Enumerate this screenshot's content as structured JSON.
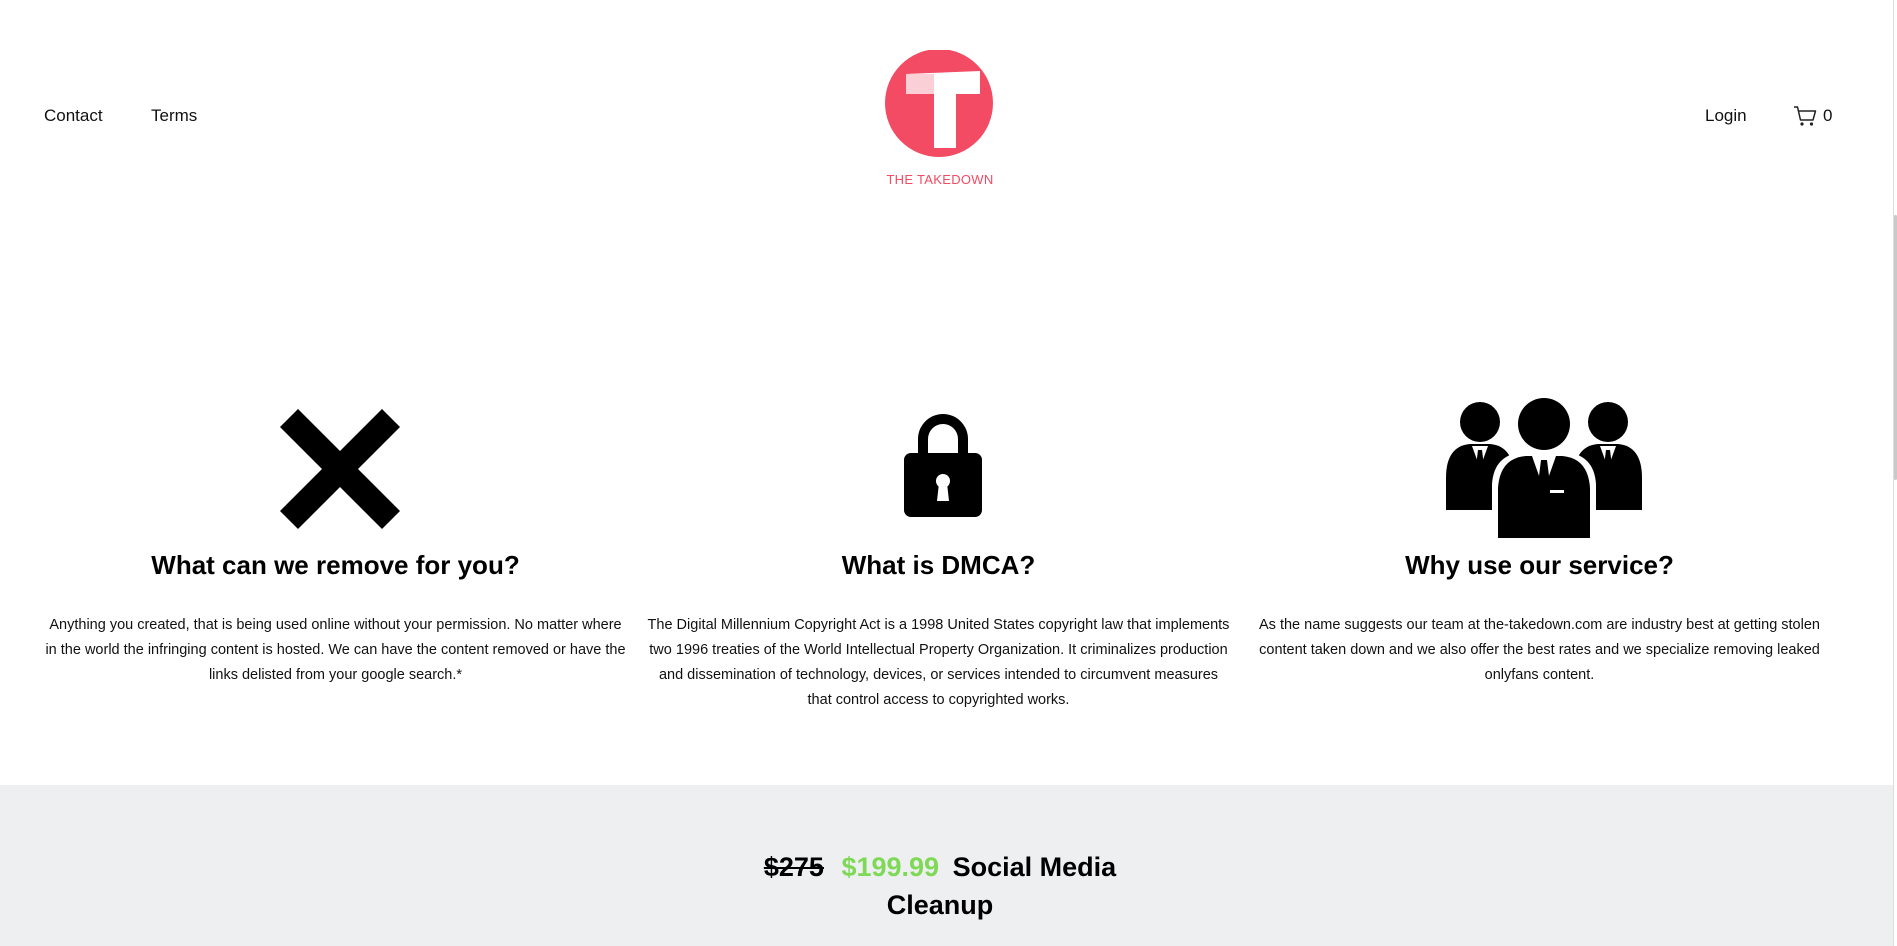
{
  "header": {
    "nav": [
      "Contact",
      "Terms"
    ],
    "logo_text": "THE TAKEDOWN",
    "login_label": "Login",
    "cart_count": "0"
  },
  "features": [
    {
      "icon": "x-icon",
      "title": "What can we remove for you?",
      "body": "Anything you created, that is being used online without your permission. No matter where in the world the infringing content is hosted. We can have the content removed or have the links delisted from your google search.*"
    },
    {
      "icon": "lock-icon",
      "title": "What is DMCA?",
      "body": "The Digital Millennium Copyright Act is a 1998 United States copyright law that implements two 1996 treaties of the World Intellectual Property Organization. It criminalizes production and dissemination of technology, devices, or services intended to circumvent measures that control access to copyrighted works."
    },
    {
      "icon": "business-team-icon",
      "title": "Why use our service?",
      "body": "As the name suggests our team at the-takedown.com are industry best at getting stolen content taken down and we also offer the best rates and we specialize removing leaked onlyfans content."
    }
  ],
  "pricing": {
    "old_price": "$275",
    "new_price": "$199.99",
    "title": "Social Media Cleanup"
  },
  "colors": {
    "brand": "#f24b63",
    "price_green": "#7ed957",
    "band_bg": "#eeeff1"
  }
}
